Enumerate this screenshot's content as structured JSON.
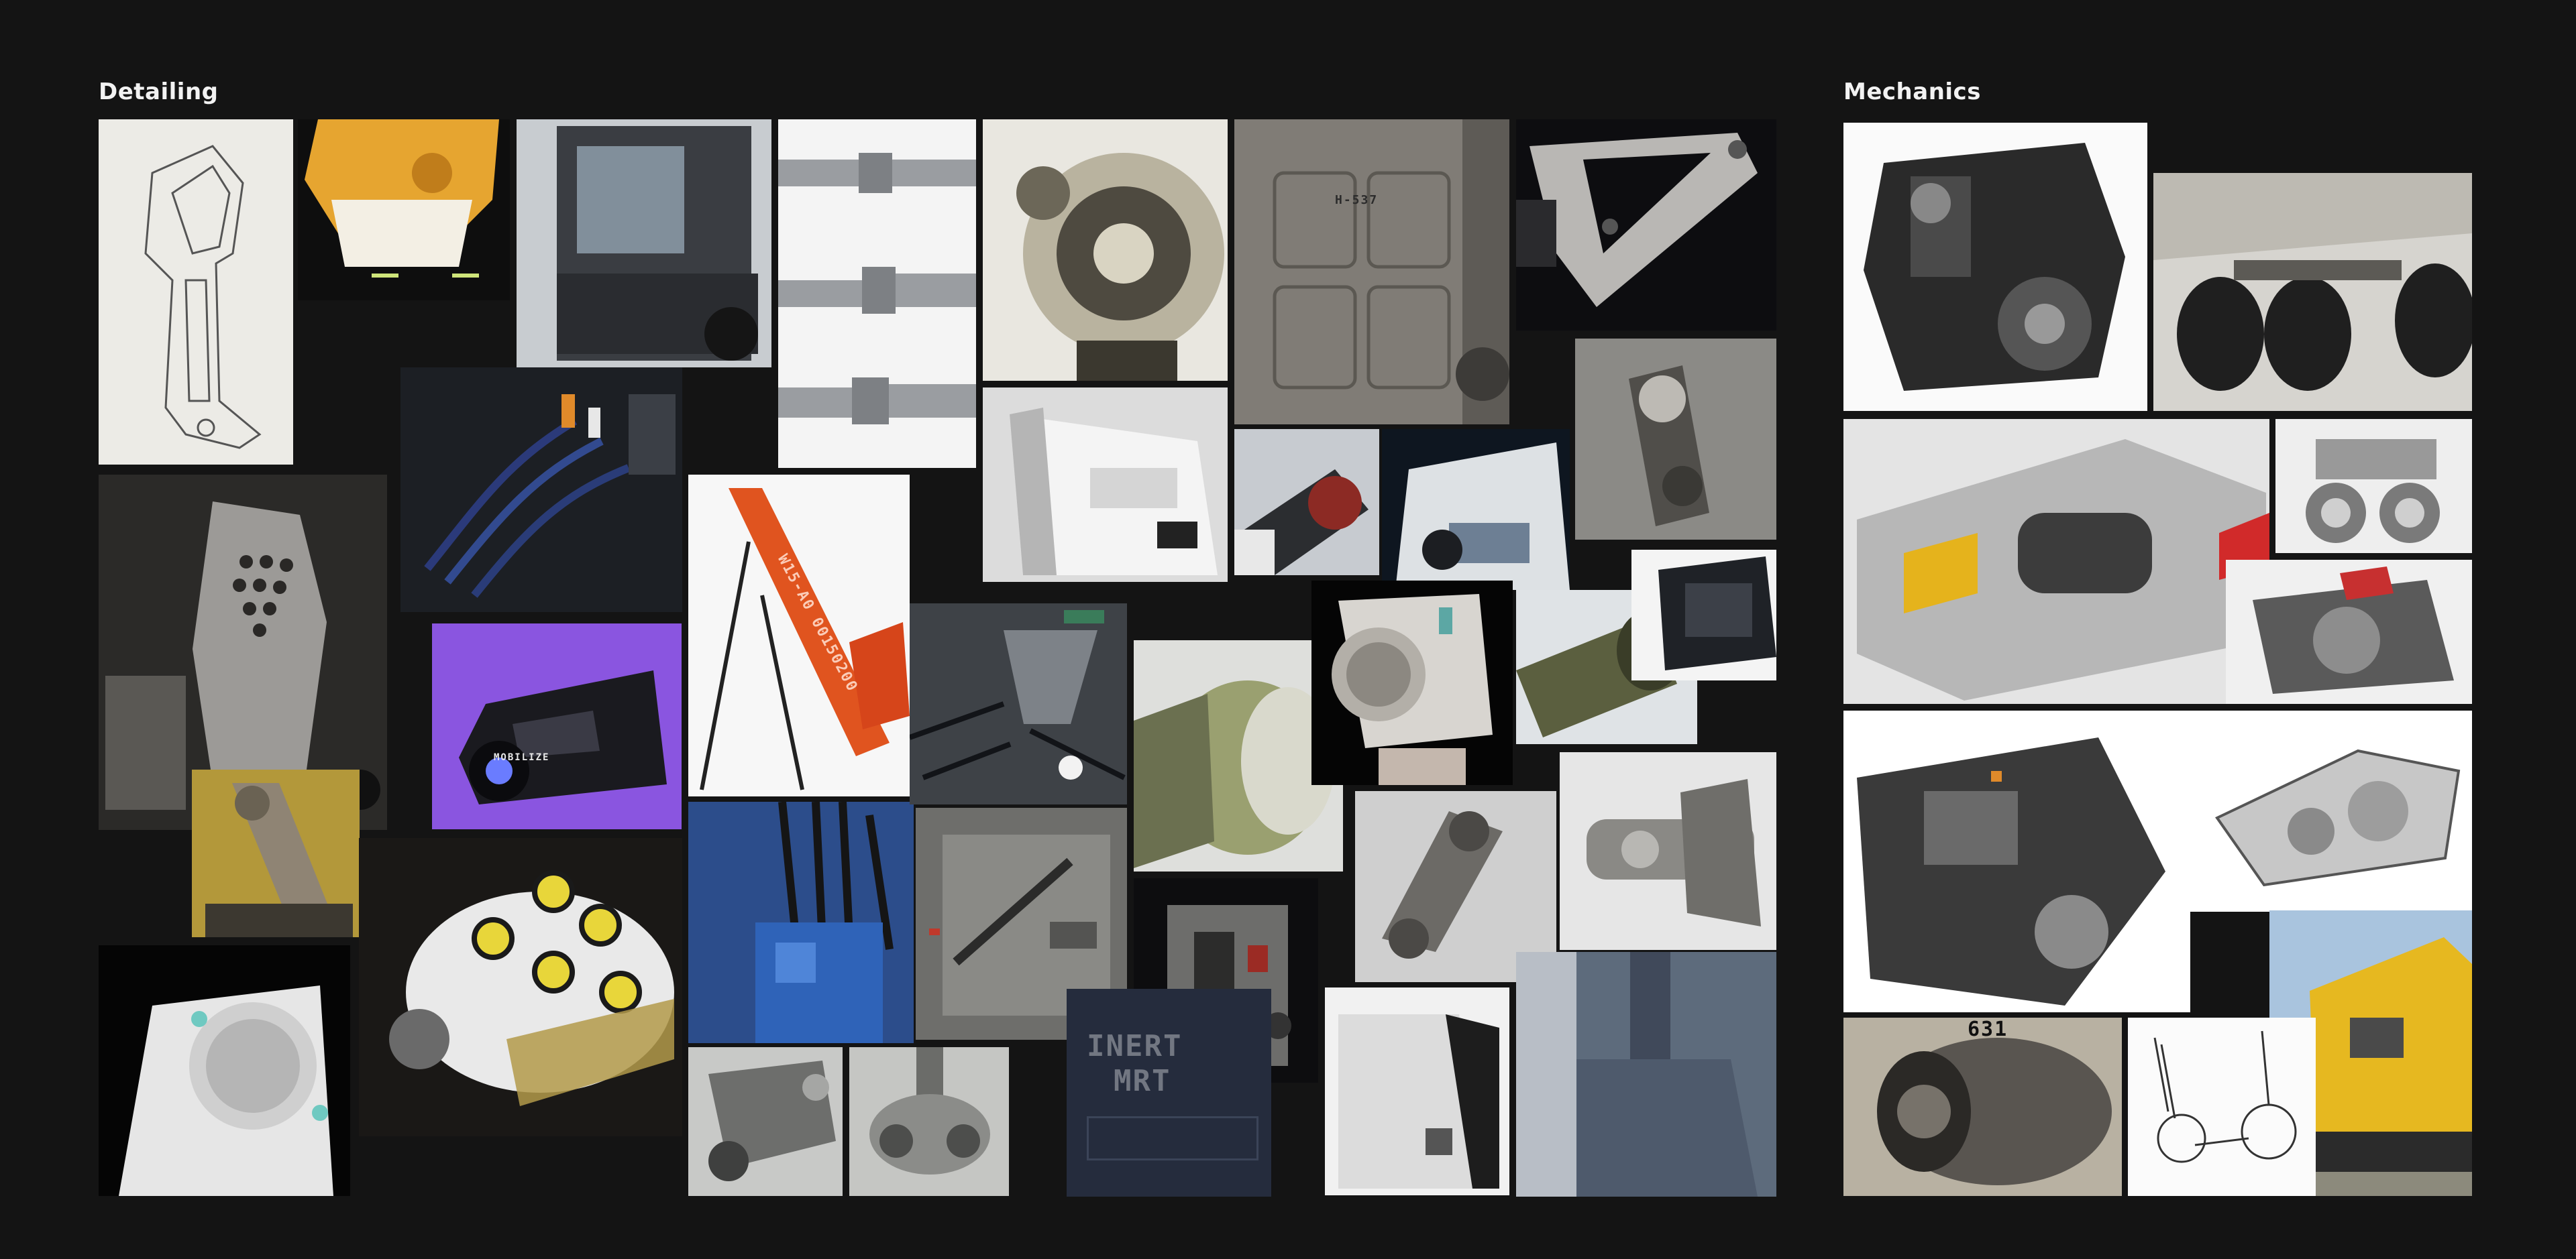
{
  "sections": {
    "detailing": {
      "title": "Detailing"
    },
    "mechanics": {
      "title": "Mechanics"
    }
  },
  "image_text": {
    "cockpit_logo": "MOBILIZE",
    "drill_mast_text": "W15-A0 00150200",
    "panel_marking": "H-537",
    "stencil_top": "INERT",
    "stencil_bottom": "MRT",
    "engine_plate": "631"
  },
  "colors": {
    "background": "#141414",
    "title_text": "#f2f2f2",
    "accent_orange": "#e0541f",
    "accent_purple": "#8a55e0",
    "accent_blue": "#2f63b8",
    "accent_yellow": "#e6b820"
  }
}
